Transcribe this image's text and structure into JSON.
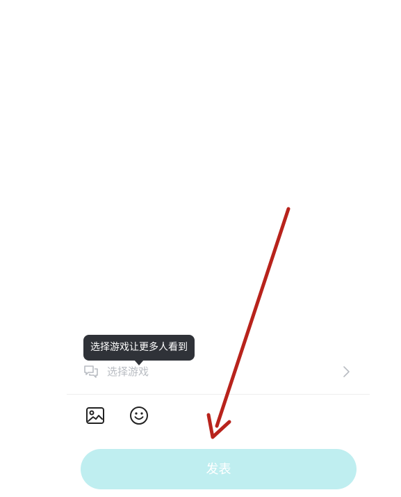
{
  "tooltip": {
    "text": "选择游戏让更多人看到"
  },
  "game_selector": {
    "label": "选择游戏",
    "icon": "chat-bubbles-icon",
    "chevron": "chevron-right-icon"
  },
  "toolbar": {
    "image_icon": "image-icon",
    "emoji_icon": "smiley-icon"
  },
  "submit": {
    "label": "发表",
    "color": "#bfeef0"
  },
  "annotation": {
    "color": "#b8231c"
  }
}
